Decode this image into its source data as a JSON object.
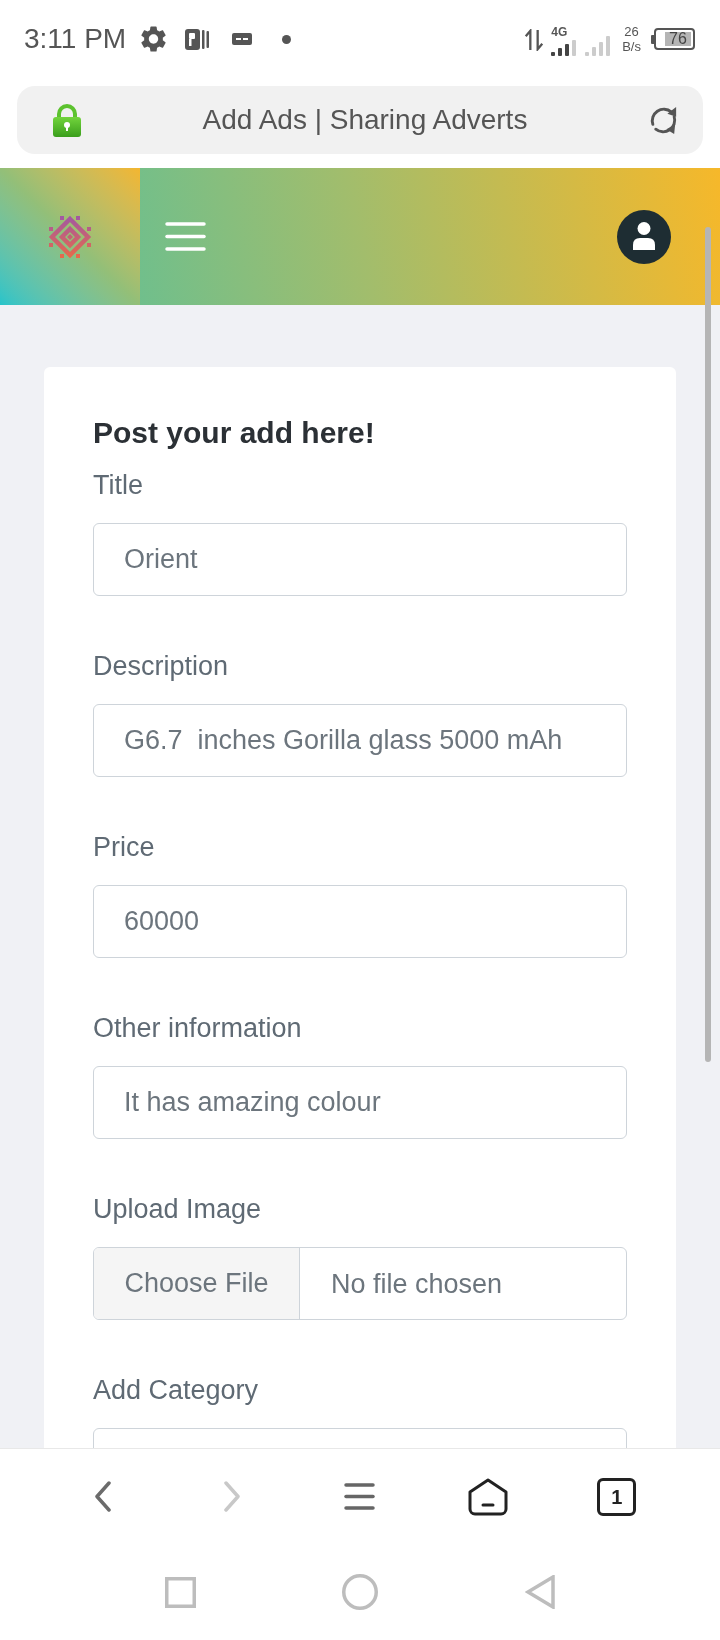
{
  "status_bar": {
    "time": "3:11 PM",
    "network_type": "4G",
    "speed": "26",
    "speed_unit": "B/s",
    "battery": "76"
  },
  "address_bar": {
    "title": "Add Ads | Sharing Adverts"
  },
  "form": {
    "title": "Post your add here!",
    "fields": [
      {
        "kind": "text",
        "label": "Title",
        "value": "Orient"
      },
      {
        "kind": "text",
        "label": "Description",
        "value": "G6.7  inches Gorilla glass 5000 mAh"
      },
      {
        "kind": "text",
        "label": "Price",
        "value": "60000"
      },
      {
        "kind": "text",
        "label": "Other information",
        "value": "It has amazing colour"
      },
      {
        "kind": "file",
        "label": "Upload Image",
        "button": "Choose File",
        "value": "No file chosen"
      },
      {
        "kind": "text",
        "label": "Add Category"
      }
    ]
  },
  "browser_nav": {
    "buttons": [
      {
        "kind": "back",
        "disabled": false
      },
      {
        "kind": "forward",
        "disabled": true
      },
      {
        "kind": "menu",
        "disabled": false
      },
      {
        "kind": "home",
        "disabled": false
      },
      {
        "kind": "tabs",
        "disabled": false,
        "count": "1"
      }
    ]
  }
}
